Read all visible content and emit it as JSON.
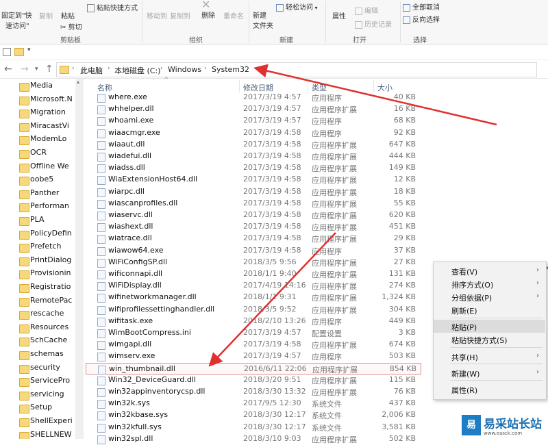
{
  "ribbon": {
    "pin_label_line1": "固定到\"快",
    "pin_label_line2": "速访问\"",
    "copy": "复制",
    "paste": "粘贴",
    "paste_shortcut": "粘贴快捷方式",
    "cut": "剪切",
    "clipboard_group": "剪贴板",
    "move_to": "移动到",
    "copy_to": "复制到",
    "delete": "删除",
    "rename": "重命名",
    "organize_group": "组织",
    "new_folder_line1": "新建",
    "new_folder_line2": "文件夹",
    "easy_access": "轻松访问",
    "new_group": "新建",
    "properties": "属性",
    "edit": "编辑",
    "history": "历史记录",
    "open_group": "打开",
    "select_all": "全部取消",
    "invert_selection": "反向选择",
    "select_group": "选择"
  },
  "address": {
    "crumbs": [
      "此电脑",
      "本地磁盘 (C:)",
      "Windows",
      "System32"
    ]
  },
  "nav": {
    "items": [
      "Media",
      "Microsoft.N",
      "Migration",
      "MiracastVi",
      "ModemLo",
      "OCR",
      "Offline We",
      "oobe5",
      "Panther",
      "Performan",
      "PLA",
      "PolicyDefin",
      "Prefetch",
      "PrintDialog",
      "Provisionin",
      "Registratio",
      "RemotePac",
      "rescache",
      "Resources",
      "SchCache",
      "schemas",
      "security",
      "ServicePro",
      "servicing",
      "Setup",
      "ShellExperi",
      "SHELLNEW"
    ]
  },
  "headers": {
    "name": "名称",
    "date": "修改日期",
    "type": "类型",
    "size": "大小"
  },
  "files": [
    {
      "name": "where.exe",
      "date": "2017/3/19 4:57",
      "type": "应用程序",
      "size": "40 KB"
    },
    {
      "name": "whhelper.dll",
      "date": "2017/3/19 4:57",
      "type": "应用程序扩展",
      "size": "16 KB"
    },
    {
      "name": "whoami.exe",
      "date": "2017/3/19 4:57",
      "type": "应用程序",
      "size": "68 KB"
    },
    {
      "name": "wiaacmgr.exe",
      "date": "2017/3/19 4:58",
      "type": "应用程序",
      "size": "92 KB"
    },
    {
      "name": "wiaaut.dll",
      "date": "2017/3/19 4:58",
      "type": "应用程序扩展",
      "size": "647 KB"
    },
    {
      "name": "wiadefui.dll",
      "date": "2017/3/19 4:58",
      "type": "应用程序扩展",
      "size": "444 KB"
    },
    {
      "name": "wiadss.dll",
      "date": "2017/3/19 4:58",
      "type": "应用程序扩展",
      "size": "149 KB"
    },
    {
      "name": "WiaExtensionHost64.dll",
      "date": "2017/3/19 4:58",
      "type": "应用程序扩展",
      "size": "12 KB"
    },
    {
      "name": "wiarpc.dll",
      "date": "2017/3/19 4:58",
      "type": "应用程序扩展",
      "size": "18 KB"
    },
    {
      "name": "wiascanprofiles.dll",
      "date": "2017/3/19 4:58",
      "type": "应用程序扩展",
      "size": "55 KB"
    },
    {
      "name": "wiaservc.dll",
      "date": "2017/3/19 4:58",
      "type": "应用程序扩展",
      "size": "620 KB"
    },
    {
      "name": "wiashext.dll",
      "date": "2017/3/19 4:58",
      "type": "应用程序扩展",
      "size": "451 KB"
    },
    {
      "name": "wiatrace.dll",
      "date": "2017/3/19 4:58",
      "type": "应用程序扩展",
      "size": "29 KB"
    },
    {
      "name": "wiawow64.exe",
      "date": "2017/3/19 4:58",
      "type": "应用程序",
      "size": "37 KB"
    },
    {
      "name": "WiFiConfigSP.dll",
      "date": "2018/3/5 9:56",
      "type": "应用程序扩展",
      "size": "27 KB"
    },
    {
      "name": "wificonnapi.dll",
      "date": "2018/1/1 9:40",
      "type": "应用程序扩展",
      "size": "131 KB"
    },
    {
      "name": "WiFiDisplay.dll",
      "date": "2017/4/19 14:16",
      "type": "应用程序扩展",
      "size": "274 KB"
    },
    {
      "name": "wifinetworkmanager.dll",
      "date": "2018/1/1 9:31",
      "type": "应用程序扩展",
      "size": "1,324 KB"
    },
    {
      "name": "wifiprofilessettinghandler.dll",
      "date": "2018/3/5 9:52",
      "type": "应用程序扩展",
      "size": "304 KB"
    },
    {
      "name": "wifitask.exe",
      "date": "2018/2/10 13:26",
      "type": "应用程序",
      "size": "449 KB"
    },
    {
      "name": "WimBootCompress.ini",
      "date": "2017/3/19 4:57",
      "type": "配置设置",
      "size": "3 KB"
    },
    {
      "name": "wimgapi.dll",
      "date": "2017/3/19 4:58",
      "type": "应用程序扩展",
      "size": "674 KB"
    },
    {
      "name": "wimserv.exe",
      "date": "2017/3/19 4:57",
      "type": "应用程序",
      "size": "503 KB"
    },
    {
      "name": "win_thumbnail.dll",
      "date": "2016/6/11 22:06",
      "type": "应用程序扩展",
      "size": "854 KB"
    },
    {
      "name": "Win32_DeviceGuard.dll",
      "date": "2018/3/20 9:51",
      "type": "应用程序扩展",
      "size": "115 KB"
    },
    {
      "name": "win32appinventorycsp.dll",
      "date": "2018/3/30 13:32",
      "type": "应用程序扩展",
      "size": "76 KB"
    },
    {
      "name": "win32k.sys",
      "date": "2017/9/5 12:30",
      "type": "系统文件",
      "size": "437 KB"
    },
    {
      "name": "win32kbase.sys",
      "date": "2018/3/30 12:17",
      "type": "系统文件",
      "size": "2,006 KB"
    },
    {
      "name": "win32kfull.sys",
      "date": "2018/3/30 12:17",
      "type": "系统文件",
      "size": "3,581 KB"
    },
    {
      "name": "win32spl.dll",
      "date": "2018/3/10 9:03",
      "type": "应用程序扩展",
      "size": "502 KB"
    }
  ],
  "context_menu": {
    "view": "查看(V)",
    "sort": "排序方式(O)",
    "group": "分组依据(P)",
    "refresh": "刷新(E)",
    "paste": "粘贴(P)",
    "paste_shortcut": "粘贴快捷方式(S)",
    "share": "共享(H)",
    "new": "新建(W)",
    "properties": "属性(R)"
  },
  "watermark": {
    "logo": "易",
    "text": "易采站长站",
    "url": "www.easck.com"
  },
  "colors": {
    "arrow": "#e03030",
    "selected_border": "#e08a8a",
    "folder": "#f7d87a"
  }
}
